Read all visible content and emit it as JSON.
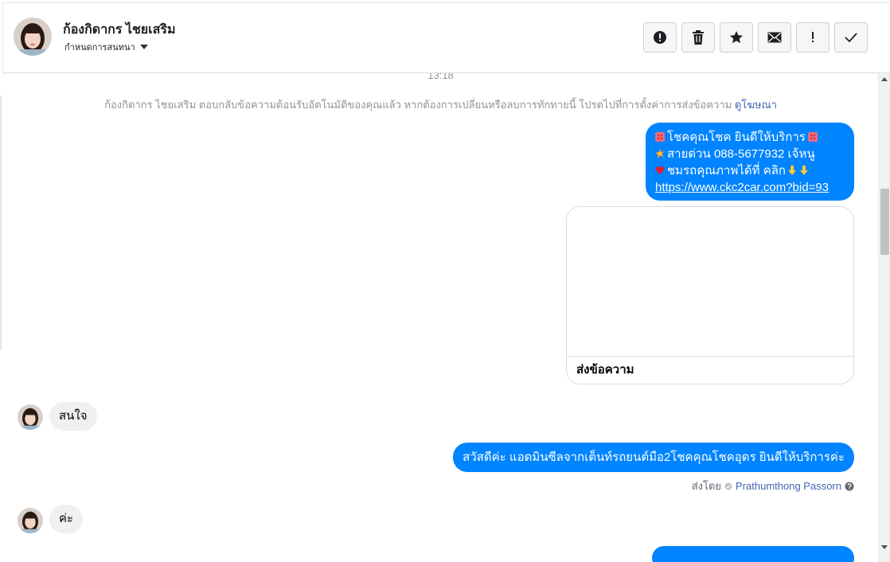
{
  "header": {
    "contact_name": "ก้องกิดากร ไชยเสริม",
    "sub_label": "กำหนดการสนทนา",
    "actions": [
      {
        "name": "report-icon",
        "label": "!"
      },
      {
        "name": "trash-icon",
        "label": ""
      },
      {
        "name": "star-icon",
        "label": ""
      },
      {
        "name": "mail-icon",
        "label": ""
      },
      {
        "name": "exclamation-icon",
        "label": "!"
      },
      {
        "name": "check-icon",
        "label": ""
      }
    ]
  },
  "thread": {
    "time": "13:18",
    "info_text": "ก้องกิดากร ไชยเสริม ตอบกลับข้อความต้อนรับอัตโนมัติของคุณแล้ว หากต้องการเปลี่ยนหรือลบการทักทายนี้ โปรดไปที่การตั้งค่าการส่งข้อความ",
    "info_link": "ดูโฆษณา",
    "outgoing_1": {
      "line1": "โชคคุณโชค ยินดีให้บริการ",
      "line2": "สายด่วน 088-5677932 เจ้หนู",
      "line3": "ชมรถคุณภาพได้ที่   คลิก",
      "link": "https://www.ckc2car.com?bid=93"
    },
    "card_button": "ส่งข้อความ",
    "incoming_1": "สนใจ",
    "outgoing_2": "สวัสดีค่ะ แอดมินซีลจากเต็นท์รถยนต์มือ2โชคคุณโชคอุดร ยินดีให้บริการค่ะ",
    "sent_by_label": "ส่งโดย",
    "sent_by_name": "Prathumthong Passorn",
    "incoming_2": "ค่ะ"
  },
  "colors": {
    "outgoing_bubble": "#0084ff",
    "incoming_bubble": "#f1f0f0",
    "link": "#4267b2"
  }
}
